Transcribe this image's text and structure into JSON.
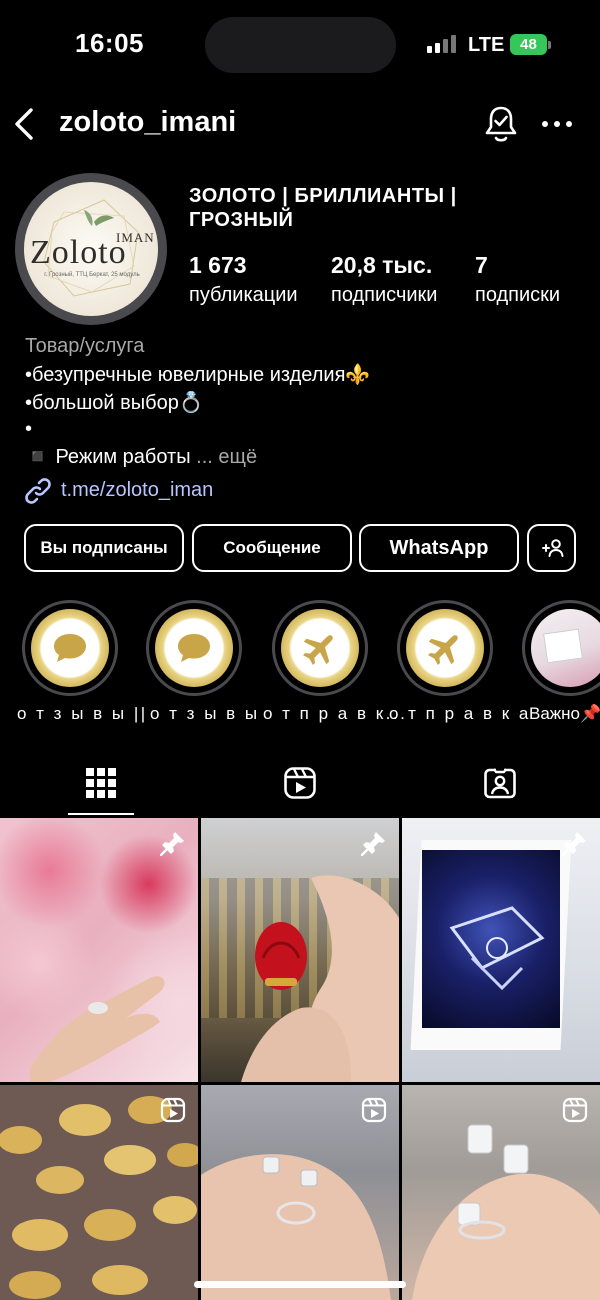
{
  "status_bar": {
    "time": "16:05",
    "network": "LTE",
    "battery": "48"
  },
  "header": {
    "username": "zoloto_imani"
  },
  "profile": {
    "avatar_logo": {
      "top": "IMAN",
      "main": "Zoloto",
      "sub": "г. Грозный, ТТЦ Беркат, 25 модуль"
    },
    "display_name": "ЗОЛОТО | БРИЛЛИАНТЫ | ГРОЗНЫЙ",
    "stats": [
      {
        "value": "1 673",
        "label": "публикации"
      },
      {
        "value": "20,8 тыс.",
        "label": "подписчики"
      },
      {
        "value": "7",
        "label": "подписки"
      }
    ],
    "category": "Товар/услуга",
    "bio": [
      "•безупречные ювелирные изделия⚜️",
      "•большой выбор💍",
      "•"
    ],
    "bio_last": "◾️ Режим работы",
    "more_label": "... ещё",
    "link": "t.me/zoloto_iman"
  },
  "buttons": {
    "subscribed": "Вы подписаны",
    "message": "Сообщение",
    "whatsapp": "WhatsApp"
  },
  "highlights": [
    {
      "label": "о т з ы в ы ||",
      "icon": "speech-bubble"
    },
    {
      "label": "о т з ы в ы",
      "icon": "speech-bubble"
    },
    {
      "label": "о т п р а в к...",
      "icon": "airplane"
    },
    {
      "label": "о т п р а в к а",
      "icon": "airplane"
    },
    {
      "label": "Важно📌",
      "icon": "photo"
    }
  ],
  "tabs": [
    "grid-icon",
    "reels-icon",
    "tagged-icon"
  ],
  "posts": [
    {
      "kind": "pinned",
      "subject": "ring on hand with roses"
    },
    {
      "kind": "pinned",
      "subject": "red rose ring box"
    },
    {
      "kind": "pinned",
      "subject": "jewelry in blue box"
    },
    {
      "kind": "reel",
      "subject": "gold rings display"
    },
    {
      "kind": "reel",
      "subject": "diamond earrings on palm"
    },
    {
      "kind": "reel",
      "subject": "diamond earrings and ring"
    }
  ],
  "colors": {
    "background": "#000000",
    "link": "#b7c6ff",
    "battery": "#35c759",
    "secondary_text": "#a8a8a8"
  }
}
